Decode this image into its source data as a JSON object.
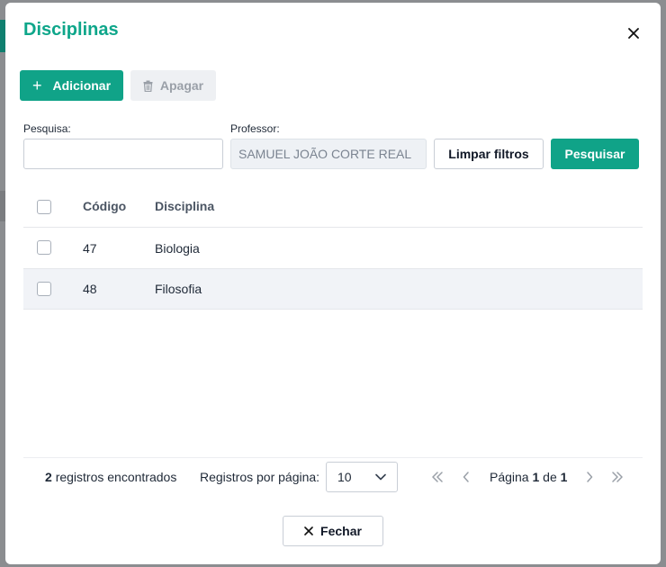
{
  "dialog": {
    "title": "Disciplinas",
    "close_icon": "close-icon"
  },
  "toolbar": {
    "add_label": "Adicionar",
    "add_icon": "plus-icon",
    "delete_label": "Apagar",
    "delete_icon": "trash-icon"
  },
  "filters": {
    "search_label": "Pesquisa:",
    "search_value": "",
    "professor_label": "Professor:",
    "professor_value": "SAMUEL JOÃO CORTE REAL",
    "clear_label": "Limpar filtros",
    "search_button_label": "Pesquisar"
  },
  "table": {
    "headers": {
      "code": "Código",
      "discipline": "Disciplina"
    },
    "rows": [
      {
        "code": "47",
        "discipline": "Biologia"
      },
      {
        "code": "48",
        "discipline": "Filosofia"
      }
    ]
  },
  "footer": {
    "count": "2",
    "count_suffix": "registros encontrados",
    "per_page_label": "Registros por página:",
    "per_page_value": "10",
    "page_prefix": "Página",
    "page_current": "1",
    "page_of": "de",
    "page_total": "1",
    "close_label": "Fechar"
  },
  "colors": {
    "accent": "#10a388",
    "title": "#0ea68a",
    "row_highlight": "#f1f3f7"
  }
}
